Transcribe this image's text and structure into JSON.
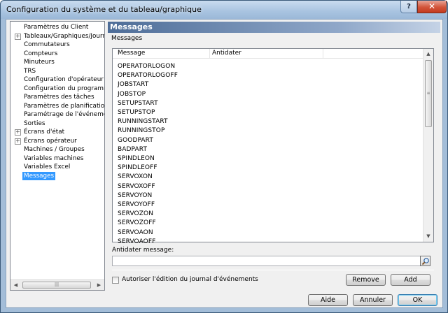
{
  "window": {
    "title": "Configuration du système et du tableau/graphique",
    "help_label": "?",
    "close_label": "✕"
  },
  "tree": {
    "items": [
      {
        "label": "Paramètres du Client",
        "expandable": false,
        "selected": false
      },
      {
        "label": "Tableaux/Graphiques/Journal",
        "expandable": true,
        "selected": false
      },
      {
        "label": "Commutateurs",
        "expandable": false,
        "selected": false
      },
      {
        "label": "Compteurs",
        "expandable": false,
        "selected": false
      },
      {
        "label": "Minuteurs",
        "expandable": false,
        "selected": false
      },
      {
        "label": "TRS",
        "expandable": false,
        "selected": false
      },
      {
        "label": "Configuration d'opérateur",
        "expandable": false,
        "selected": false
      },
      {
        "label": "Configuration du programme",
        "expandable": false,
        "selected": false
      },
      {
        "label": "Paramètres des tâches",
        "expandable": false,
        "selected": false
      },
      {
        "label": "Paramètres de planification",
        "expandable": false,
        "selected": false
      },
      {
        "label": "Paramétrage de l'événement",
        "expandable": false,
        "selected": false
      },
      {
        "label": "Sorties",
        "expandable": false,
        "selected": false
      },
      {
        "label": "Écrans d'état",
        "expandable": true,
        "selected": false
      },
      {
        "label": "Écrans opérateur",
        "expandable": true,
        "selected": false
      },
      {
        "label": "Machines / Groupes",
        "expandable": false,
        "selected": false
      },
      {
        "label": "Variables machines",
        "expandable": false,
        "selected": false
      },
      {
        "label": "Variables Excel",
        "expandable": false,
        "selected": false
      },
      {
        "label": "Messages",
        "expandable": false,
        "selected": true
      }
    ],
    "hscroll_grip": "|||"
  },
  "header": {
    "title": "Messages",
    "subtitle": "Messages"
  },
  "list": {
    "columns": [
      "Message",
      "Antidater"
    ],
    "rows": [
      "OPERATORLOGON",
      "OPERATORLOGOFF",
      "JOBSTART",
      "JOBSTOP",
      "SETUPSTART",
      "SETUPSTOP",
      "RUNNINGSTART",
      "RUNNINGSTOP",
      "GOODPART",
      "BADPART",
      "SPINDLEON",
      "SPINDLEOFF",
      "SERVOXON",
      "SERVOXOFF",
      "SERVOYON",
      "SERVOYOFF",
      "SERVOZON",
      "SERVOZOFF",
      "SERVOAON",
      "SERVOAOFF"
    ],
    "vscroll_grip": "≡"
  },
  "antidater": {
    "label": "Antidater message:",
    "value": ""
  },
  "options": {
    "allow_edit_label": "Autoriser l'édition du journal d'événements",
    "allow_edit_checked": false
  },
  "buttons": {
    "remove": "Remove",
    "add": "Add",
    "help": "Aide",
    "cancel": "Annuler",
    "ok": "OK"
  }
}
